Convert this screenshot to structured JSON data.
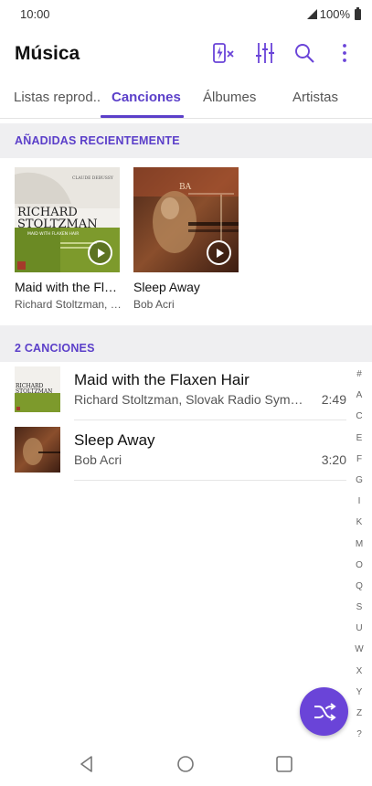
{
  "status_bar": {
    "time": "10:00",
    "battery": "100%"
  },
  "app_bar": {
    "title": "Música",
    "icons": [
      "lightning-card-off-icon",
      "equalizer-icon",
      "search-icon",
      "more-vert-icon"
    ]
  },
  "tabs": [
    {
      "label": "Listas reprod..",
      "active": false
    },
    {
      "label": "Canciones",
      "active": true
    },
    {
      "label": "Álbumes",
      "active": false
    },
    {
      "label": "Artistas",
      "active": false
    }
  ],
  "recent": {
    "header": "AÑADIDAS RECIENTEMENTE",
    "albums": [
      {
        "title": "Maid with the Flaxen Hair",
        "artist": "Richard Stoltzman, Slovak Radio Symphony Orchestra",
        "art_text_1": "RICHARD",
        "art_text_2": "STOLTZMAN",
        "art_text_3": "MAID WITH FLAXEN HAIR",
        "art_text_4": "CLAUDE DEBUSSY"
      },
      {
        "title": "Sleep Away",
        "artist": "Bob Acri",
        "art_text_1": "BA"
      }
    ]
  },
  "songs": {
    "header": "2 CANCIONES",
    "items": [
      {
        "title": "Maid with the Flaxen Hair",
        "artist": "Richard Stoltzman, Slovak Radio Symphony Orchestra",
        "duration": "2:49"
      },
      {
        "title": "Sleep Away",
        "artist": "Bob Acri",
        "duration": "3:20"
      }
    ]
  },
  "alphabet_index": [
    "#",
    "A",
    "C",
    "E",
    "F",
    "G",
    "I",
    "K",
    "M",
    "O",
    "Q",
    "S",
    "U",
    "W",
    "X",
    "Y",
    "Z",
    "?"
  ],
  "colors": {
    "accent": "#5b3fc9",
    "fab": "#6a44d8",
    "section_bg": "#efeff1"
  }
}
